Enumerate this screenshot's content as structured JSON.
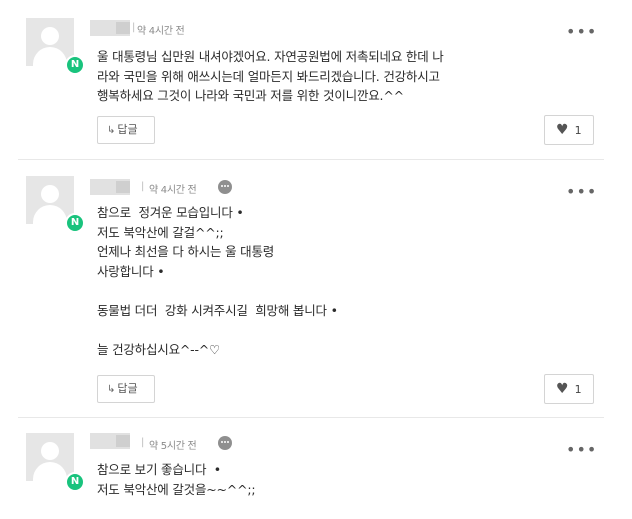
{
  "comments": [
    {
      "time": "약 4시간 전",
      "has_chat_icon": false,
      "text": "울 대통령님 십만원 내셔야겠어요. 자연공원법에 저촉되네요 한데 나\n라와 국민을 위해 애쓰시는데 얼마든지 봐드리겠습니다. 건강하시고\n행복하세요 그것이 나라와 국민과 저를 위한 것이니깐요.^^",
      "reply_label": "답글",
      "like_count": "1"
    },
    {
      "time": "약 4시간 전",
      "has_chat_icon": true,
      "text": "참으로  정겨운 모습입니다 •\n저도 북악산에 갈걸^^;;\n언제나 최선을 다 하시는 울 대통령\n사랑합니다 •\n\n동물법 더더  강화 시켜주시길  희망해 봅니다 •\n\n늘 건강하십시요^--^♡",
      "reply_label": "답글",
      "like_count": "1"
    },
    {
      "time": "약 5시간 전",
      "has_chat_icon": true,
      "text": "참으로 보기 좋습니다  •\n저도 북악산에 갈것을~~^^;;",
      "reply_label": "",
      "like_count": ""
    }
  ],
  "icons": {
    "badge_letter": "N",
    "more": "•••",
    "reply_arrow": "↳",
    "heart": "♥"
  },
  "colors": {
    "badge": "#19c37d",
    "divider": "#e8e8e8"
  }
}
